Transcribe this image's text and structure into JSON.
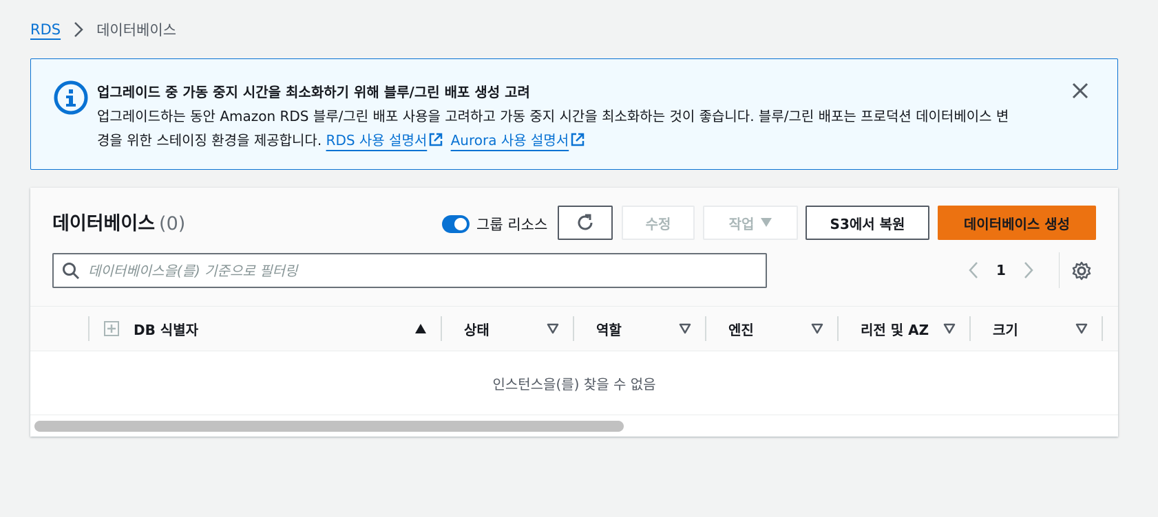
{
  "breadcrumb": {
    "root": "RDS",
    "current": "데이터베이스"
  },
  "alert": {
    "title": "업그레이드 중 가동 중지 시간을 최소화하기 위해 블루/그린 배포 생성 고려",
    "body_line1": "업그레이드하는 동안 Amazon RDS 블루/그린 배포 사용을 고려하고 가동 중지 시간을 최소화하는 것이 좋습니다. 블루/그린 배포는 프로덕션 데이터베이스 변",
    "body_line2": "경을 위한 스테이징 환경을 제공합니다.",
    "link_rds": "RDS 사용 설명서",
    "link_aurora": "Aurora 사용 설명서",
    "icon": "info-icon",
    "accent": "#0972d3",
    "background": "#f1faff"
  },
  "panel": {
    "title": "데이터베이스",
    "count": "(0)",
    "group_toggle_label": "그룹 리소스",
    "group_toggle_on": true,
    "buttons": {
      "edit": "수정",
      "actions": "작업",
      "restore_s3": "S3에서 복원",
      "create": "데이터베이스 생성"
    },
    "search_placeholder": "데이터베이스을(를) 기준으로 필터링",
    "page": "1",
    "primary_color": "#ec7211"
  },
  "table": {
    "columns": [
      "DB 식별자",
      "상태",
      "역할",
      "엔진",
      "리전 및 AZ",
      "크기"
    ],
    "sorted_column": "DB 식별자",
    "sort_direction": "ascending",
    "empty_message": "인스턴스을(를) 찾을 수 없음"
  }
}
